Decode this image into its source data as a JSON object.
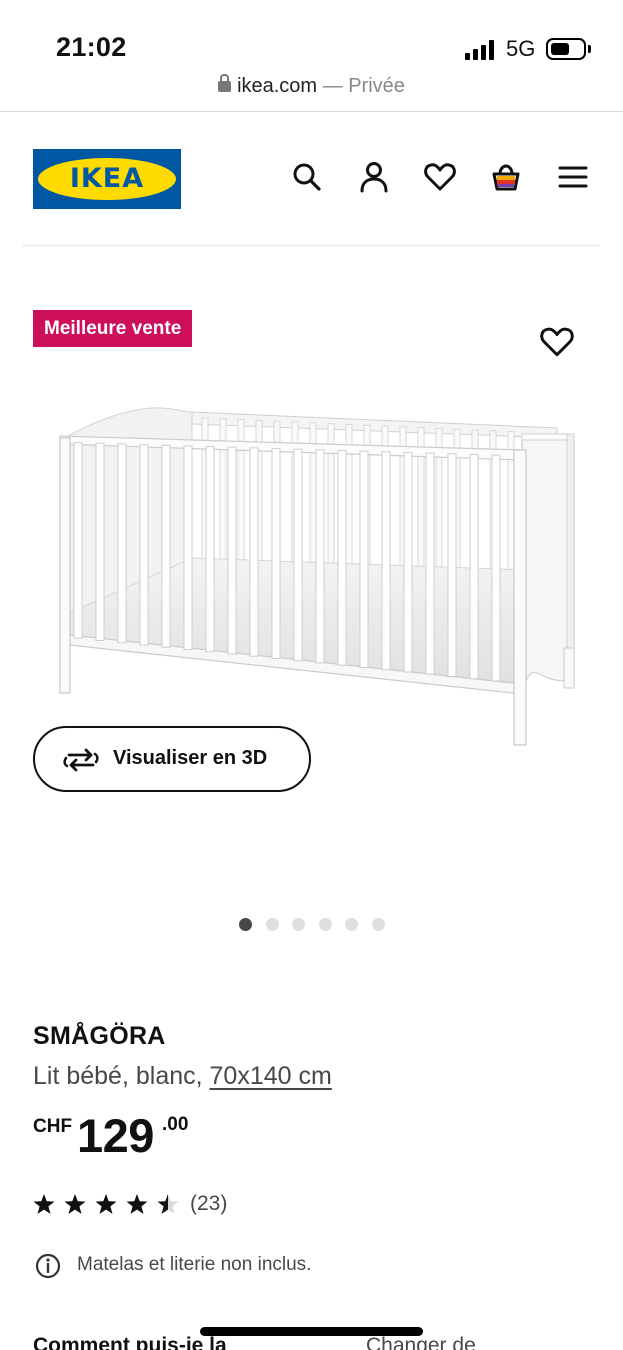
{
  "status_bar": {
    "time": "21:02",
    "network": "5G",
    "icons": [
      "signal-icon",
      "battery-icon"
    ]
  },
  "url_bar": {
    "domain": "ikea.com",
    "separator": " — ",
    "mode": "Privée",
    "icon": "lock-icon"
  },
  "header": {
    "logo_text": "IKEA",
    "brand_colors": {
      "blue": "#0058a3",
      "yellow": "#ffdb00"
    },
    "icons": [
      "search-icon",
      "account-icon",
      "wishlist-heart-icon",
      "cart-icon",
      "menu-icon"
    ]
  },
  "product": {
    "badge": "Meilleure vente",
    "badge_color": "#cc0e5b",
    "favorite_icon": "heart-icon",
    "image_description_icon": "crib-image",
    "view_3d_label": "Visualiser en 3D",
    "view_3d_icon": "rotate-3d-icon",
    "gallery_count": 6,
    "gallery_active_index": 0,
    "name": "SMÅGÖRA",
    "description": "Lit bébé, blanc, ",
    "size": "70x140 cm",
    "price": {
      "currency": "CHF",
      "integer": "129",
      "decimal": ".00"
    },
    "rating": 4.5,
    "rating_max": 5,
    "review_count": "(23)",
    "notice": "Matelas et literie non inclus.",
    "notice_icon": "info-icon"
  },
  "bottom": {
    "left_text": "Comment puis-je la",
    "right_text": "Changer de"
  }
}
